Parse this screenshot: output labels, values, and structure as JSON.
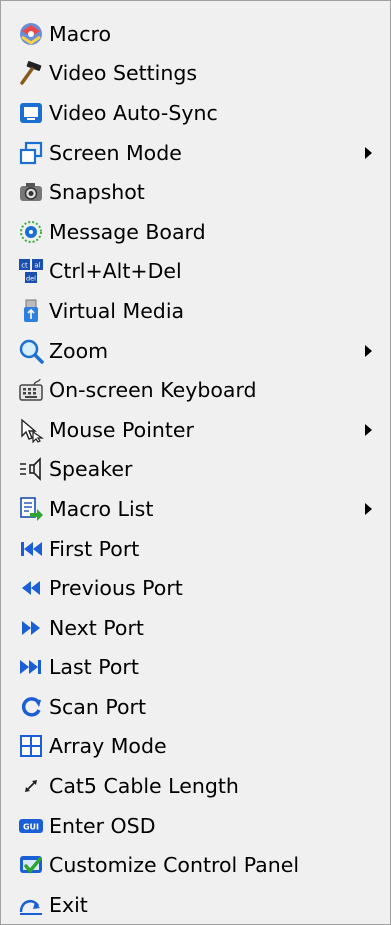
{
  "menu": {
    "items": [
      {
        "label": "Macro",
        "icon": "macro-icon",
        "submenu": false
      },
      {
        "label": "Video Settings",
        "icon": "hammer-icon",
        "submenu": false
      },
      {
        "label": "Video Auto-Sync",
        "icon": "monitor-icon",
        "submenu": false
      },
      {
        "label": "Screen Mode",
        "icon": "window-icon",
        "submenu": true
      },
      {
        "label": "Snapshot",
        "icon": "camera-icon",
        "submenu": false
      },
      {
        "label": "Message Board",
        "icon": "message-board-icon",
        "submenu": false
      },
      {
        "label": "Ctrl+Alt+Del",
        "icon": "ctrl-alt-del-icon",
        "submenu": false
      },
      {
        "label": "Virtual Media",
        "icon": "usb-icon",
        "submenu": false
      },
      {
        "label": "Zoom",
        "icon": "magnifier-icon",
        "submenu": true
      },
      {
        "label": "On-screen Keyboard",
        "icon": "keyboard-icon",
        "submenu": false
      },
      {
        "label": "Mouse Pointer",
        "icon": "pointer-icon",
        "submenu": true
      },
      {
        "label": "Speaker",
        "icon": "speaker-icon",
        "submenu": false
      },
      {
        "label": "Macro List",
        "icon": "macro-list-icon",
        "submenu": true
      },
      {
        "label": "First Port",
        "icon": "first-port-icon",
        "submenu": false
      },
      {
        "label": "Previous Port",
        "icon": "previous-port-icon",
        "submenu": false
      },
      {
        "label": "Next Port",
        "icon": "next-port-icon",
        "submenu": false
      },
      {
        "label": "Last Port",
        "icon": "last-port-icon",
        "submenu": false
      },
      {
        "label": "Scan Port",
        "icon": "scan-port-icon",
        "submenu": false
      },
      {
        "label": "Array Mode",
        "icon": "grid-icon",
        "submenu": false
      },
      {
        "label": "Cat5 Cable Length",
        "icon": "cable-length-icon",
        "submenu": false
      },
      {
        "label": "Enter OSD",
        "icon": "osd-icon",
        "submenu": false
      },
      {
        "label": "Customize Control Panel",
        "icon": "customize-icon",
        "submenu": false
      },
      {
        "label": "Exit",
        "icon": "exit-icon",
        "submenu": false
      }
    ]
  }
}
